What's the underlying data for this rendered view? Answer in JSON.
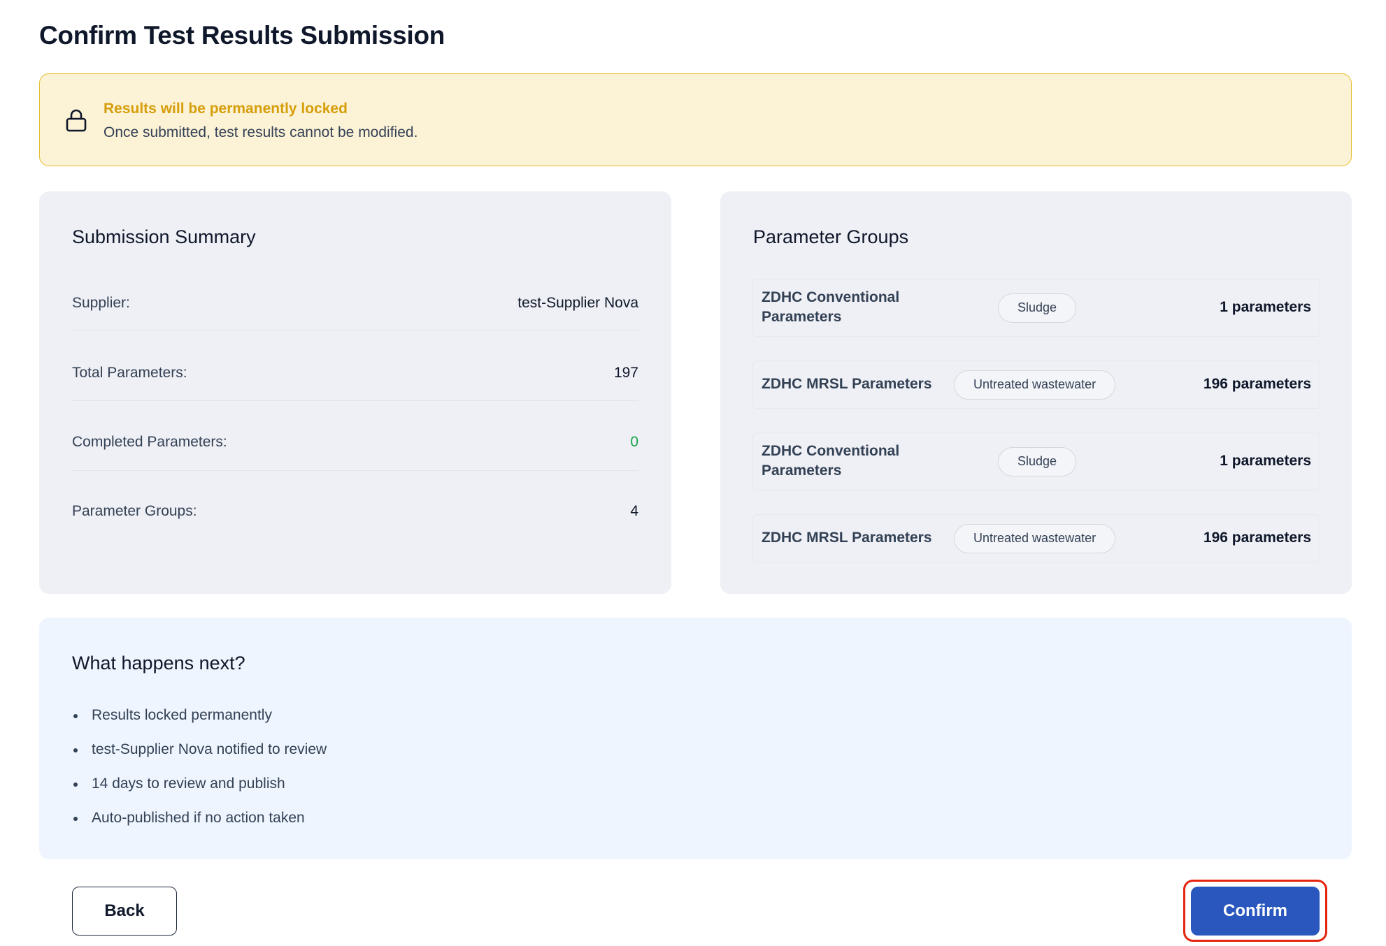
{
  "page": {
    "title": "Confirm Test Results Submission"
  },
  "warning": {
    "icon": "lock-icon",
    "title": "Results will be permanently locked",
    "text": "Once submitted, test results cannot be modified."
  },
  "summary": {
    "title": "Submission Summary",
    "rows": [
      {
        "label": "Supplier:",
        "value": "test-Supplier Nova"
      },
      {
        "label": "Total Parameters:",
        "value": "197"
      },
      {
        "label": "Completed Parameters:",
        "value": "0"
      },
      {
        "label": "Parameter Groups:",
        "value": "4"
      }
    ]
  },
  "groups": {
    "title": "Parameter Groups",
    "items": [
      {
        "name_line1": "ZDHC Conventional",
        "name_line2": "Parameters",
        "tag": "Sludge",
        "count": "1 parameters"
      },
      {
        "name_line1": "ZDHC MRSL Parameters",
        "name_line2": "",
        "tag": "Untreated wastewater",
        "count": "196 parameters"
      },
      {
        "name_line1": "ZDHC Conventional",
        "name_line2": "Parameters",
        "tag": "Sludge",
        "count": "1 parameters"
      },
      {
        "name_line1": "ZDHC MRSL Parameters",
        "name_line2": "",
        "tag": "Untreated wastewater",
        "count": "196 parameters"
      }
    ]
  },
  "next": {
    "title": "What happens next?",
    "items": [
      "Results locked permanently",
      "test-Supplier Nova notified to review",
      "14 days to review and publish",
      "Auto-published if no action taken"
    ]
  },
  "actions": {
    "back_label": "Back",
    "confirm_label": "Confirm"
  },
  "colors": {
    "accent": "#2a57be",
    "warning_bg": "#fcf2d6",
    "warning_text": "#d69e0a",
    "success": "#16a34a",
    "highlight": "#e5250f"
  }
}
